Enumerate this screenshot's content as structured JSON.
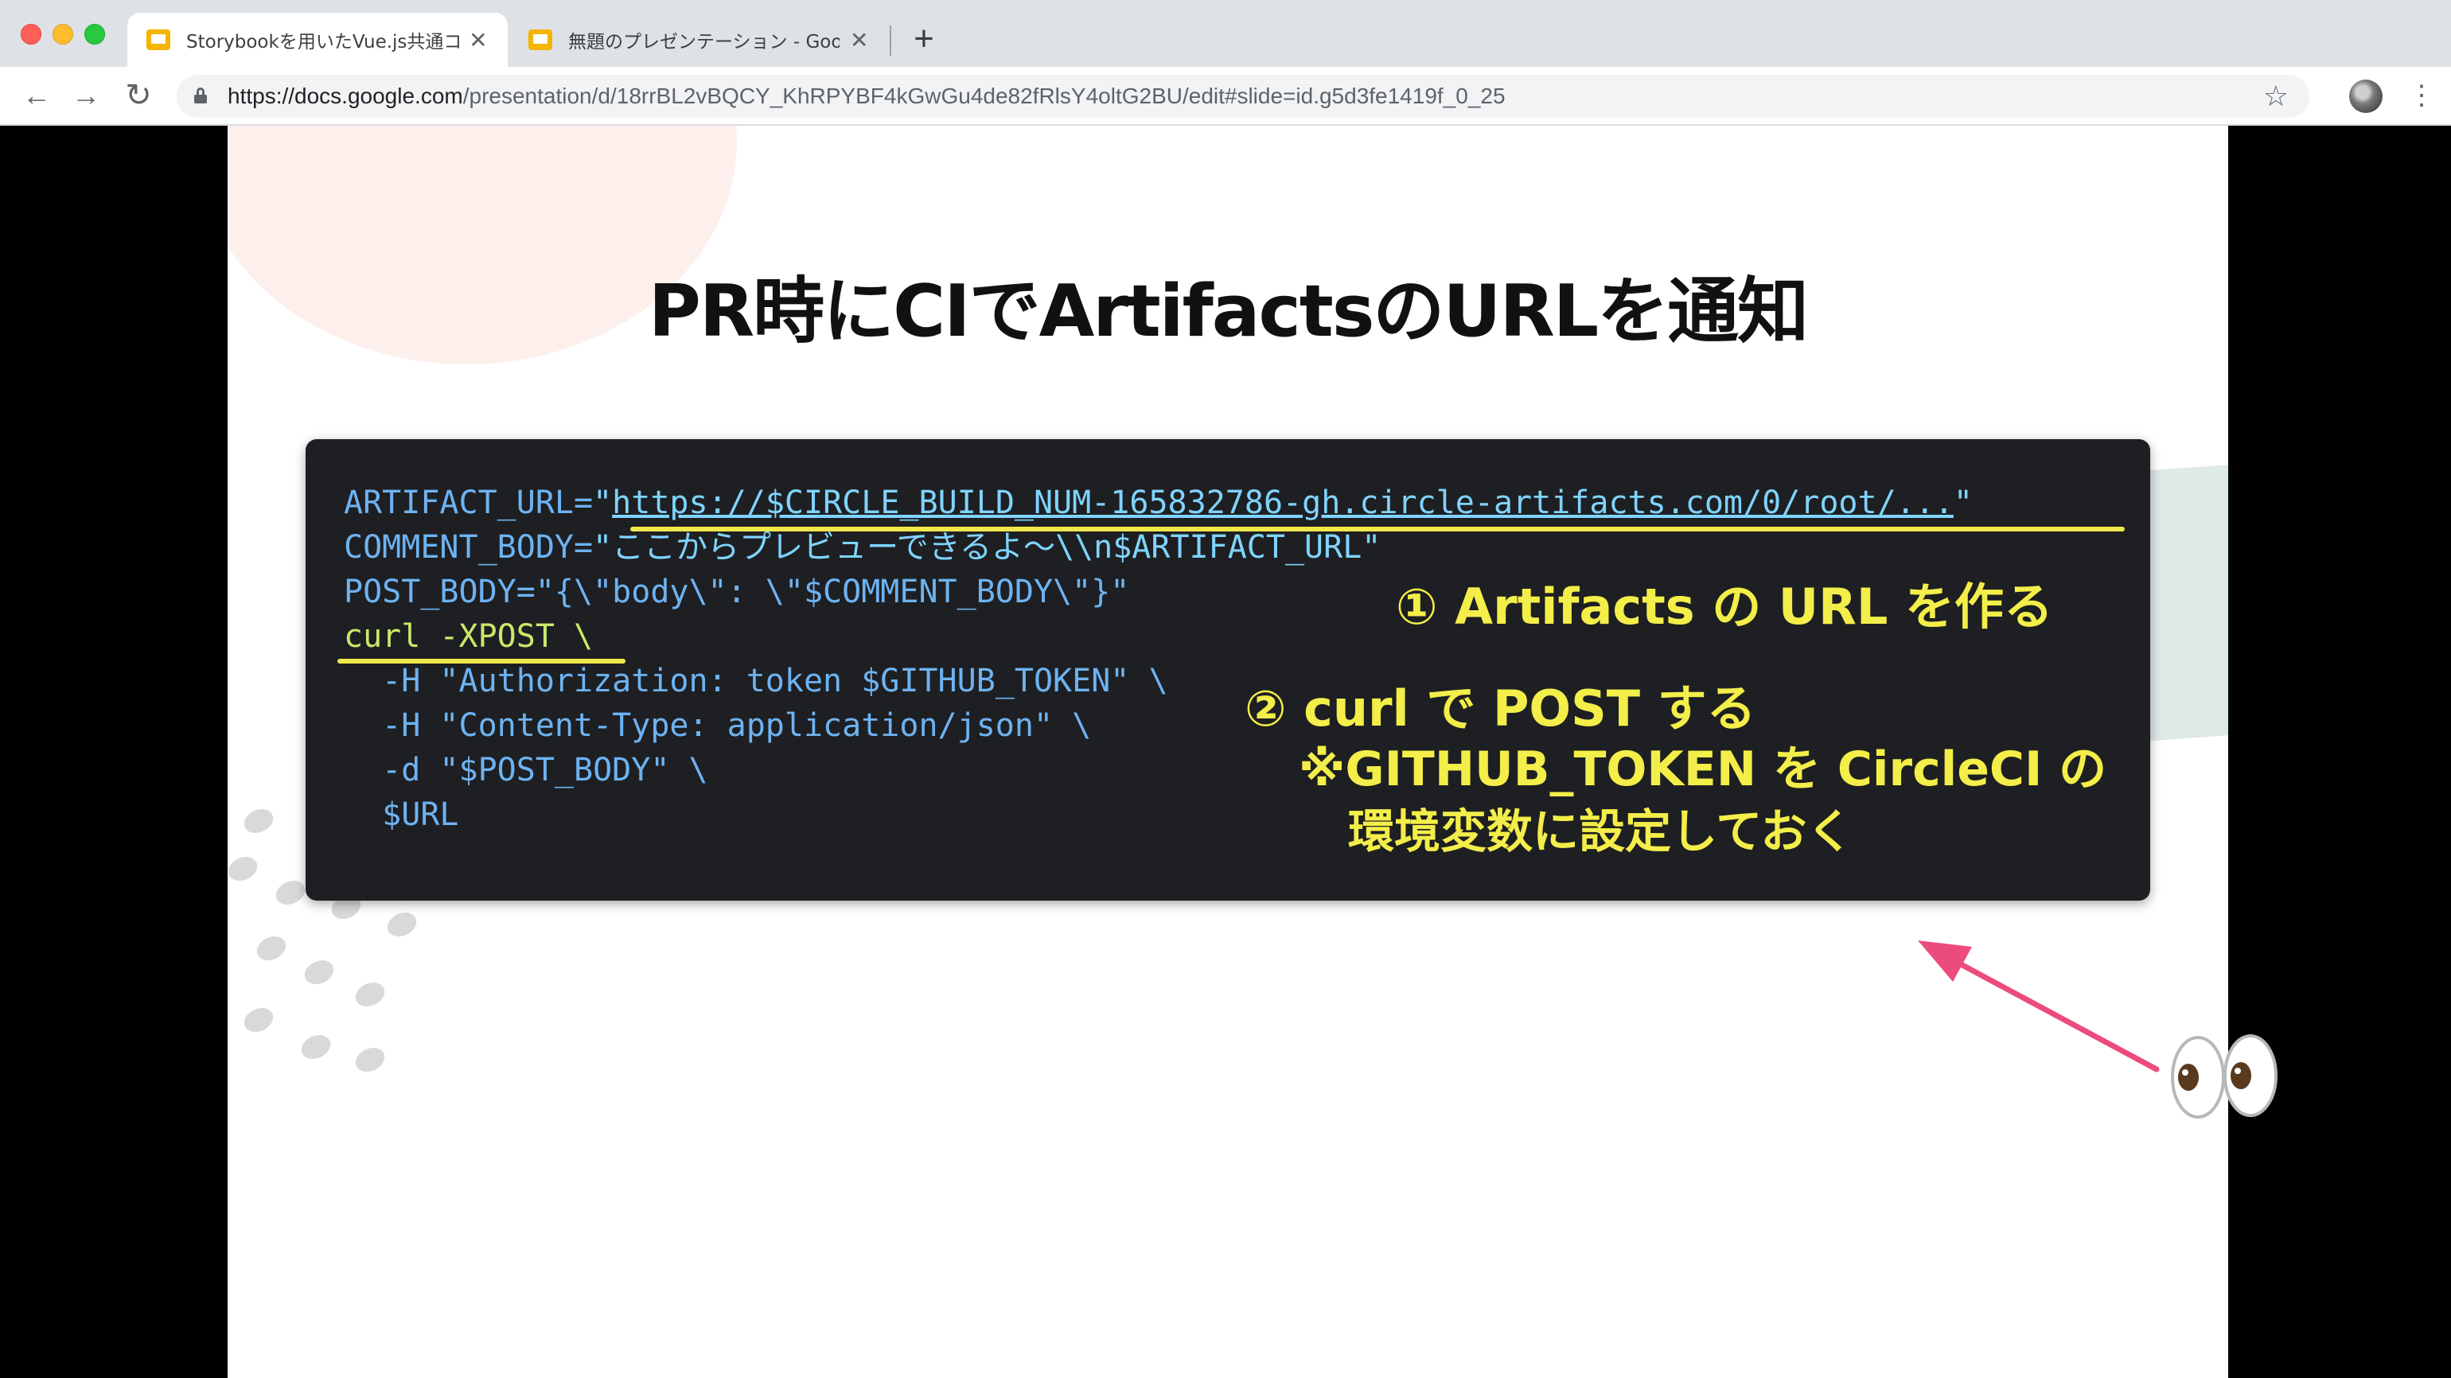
{
  "browser": {
    "tabs": [
      {
        "title": "Storybookを用いたVue.js共通コンポ",
        "active": true,
        "close": "✕",
        "icon": "slides-icon"
      },
      {
        "title": "無題のプレゼンテーション - Goog",
        "active": false,
        "close": "✕",
        "icon": "slides-icon"
      }
    ],
    "new_tab": "+",
    "url_host": "https://docs.google.com",
    "url_path": "/presentation/d/18rrBL2vBQCY_KhRPYBF4kGwGu4de82fRlsY4oltG2BU/edit#slide=id.g5d3fe1419f_0_25",
    "nav": {
      "back": "←",
      "forward": "→",
      "reload": "↻"
    },
    "star": "☆",
    "menu": "⋮"
  },
  "slide": {
    "title": "PR時にCIでArtifactsのURLを通知",
    "code": {
      "line1_var": "ARTIFACT_URL=",
      "line1_q1": "\"",
      "line1_url": "https://$CIRCLE_BUILD_NUM-165832786-gh.circle-artifacts.com/0/root/...",
      "line1_q2": "\"",
      "line2_var": "COMMENT_BODY=",
      "line2_str": "\"ここからプレビューできるよ〜\\\\n$ARTIFACT_URL\"",
      "line3": "POST_BODY=\"{\\\"body\\\": \\\"$COMMENT_BODY\\\"}\"",
      "line4": "curl -XPOST \\",
      "line5": "  -H \"Authorization: token $GITHUB_TOKEN\" \\",
      "line6": "  -H \"Content-Type: application/json\" \\",
      "line7": "  -d \"$POST_BODY\" \\",
      "line8": "  $URL"
    },
    "annotations": {
      "step1": "① Artifacts の URL を作る",
      "step2": "② curl で POST する",
      "note_line1": "※GITHUB_TOKEN を CircleCI の",
      "note_line2": "環境変数に設定しておく"
    },
    "colors": {
      "code_bg": "#1e1f22",
      "code_text": "#6db3f2",
      "annotation": "#f3ee49",
      "arrow": "#ec4c7c"
    },
    "emoji": "👀"
  }
}
